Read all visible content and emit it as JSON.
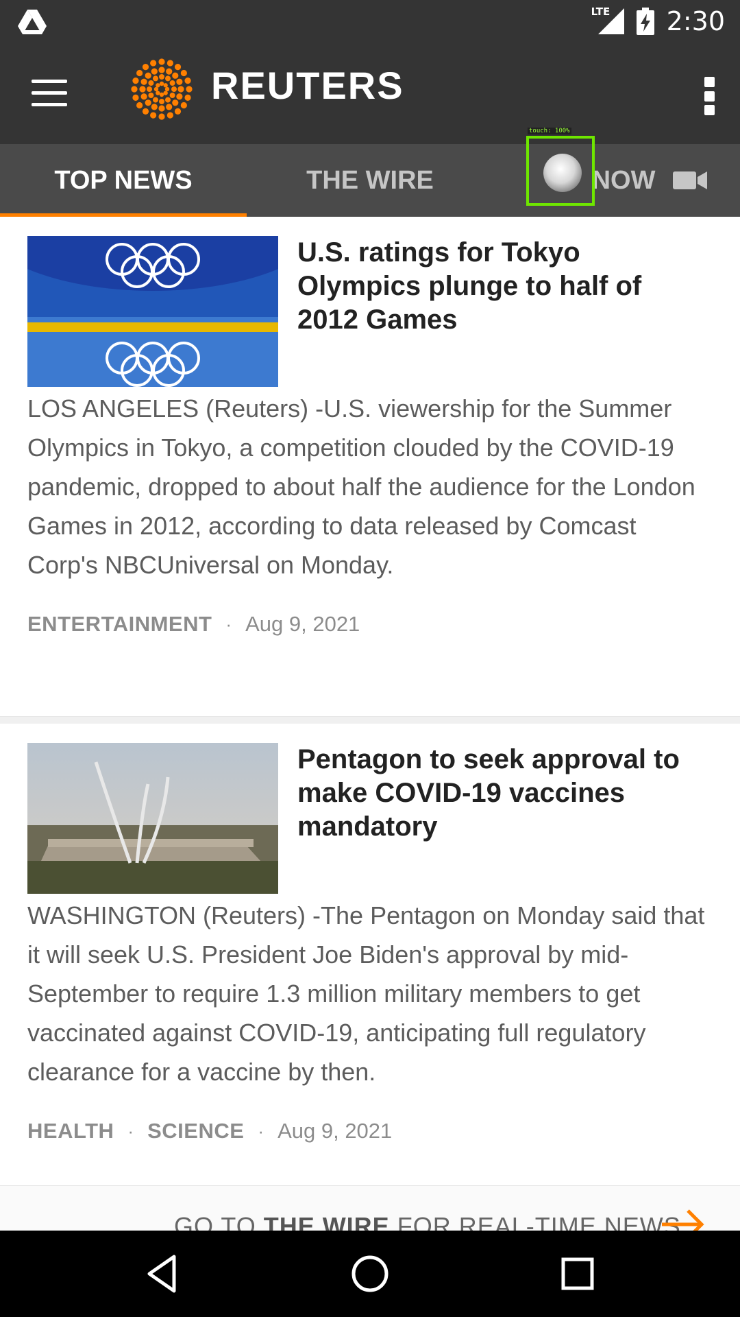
{
  "status_bar": {
    "time": "2:30",
    "network": "LTE",
    "icons": [
      "drive-icon",
      "signal-icon",
      "battery-charging-icon"
    ]
  },
  "app_bar": {
    "brand": "REUTERS",
    "colors": {
      "background": "#343434",
      "accent": "#ff8000"
    }
  },
  "tabs": [
    {
      "label": "TOP NEWS",
      "active": true
    },
    {
      "label": "THE WIRE",
      "active": false
    },
    {
      "label": "NOW",
      "active": false,
      "icon": "video-camera-icon"
    }
  ],
  "touch_overlay": {
    "label": "touch: 100%"
  },
  "articles": [
    {
      "headline": "U.S. ratings for Tokyo Olympics plunge to half of 2012 Games",
      "summary": "LOS ANGELES (Reuters) -U.S. viewership for the Summer Olympics in Tokyo, a competition clouded by the COVID-19 pandemic, dropped to about half the audience for the London Games in 2012, according to data released by Comcast Corp's NBCUniversal on Monday.",
      "categories": [
        "ENTERTAINMENT"
      ],
      "date": "Aug 9, 2021"
    },
    {
      "headline": "Pentagon to seek approval to make COVID-19 vaccines mandatory",
      "summary": "WASHINGTON (Reuters) -The Pentagon on Monday said that it will seek U.S. President Joe Biden's approval by mid-September to require 1.3 million military members to get vaccinated against COVID-19, anticipating full regulatory clearance for a vaccine by then.",
      "categories": [
        "HEALTH",
        "SCIENCE"
      ],
      "date": "Aug 9, 2021"
    }
  ],
  "wire_link": {
    "prefix": "GO TO ",
    "emphasis": "THE WIRE",
    "suffix": " FOR REAL-TIME NEWS"
  },
  "nav_bar": [
    "back-icon",
    "home-icon",
    "recents-icon"
  ]
}
